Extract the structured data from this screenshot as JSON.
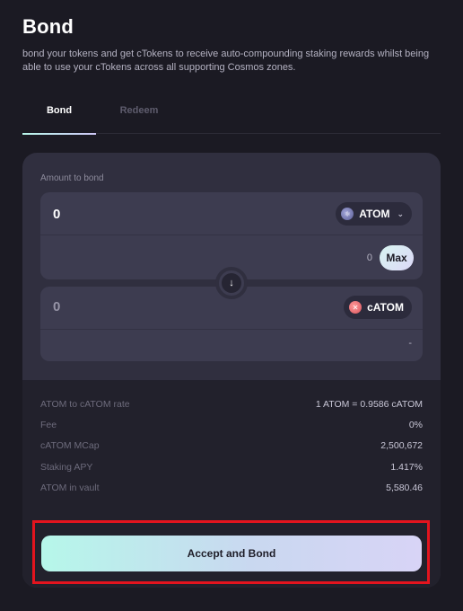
{
  "page": {
    "title": "Bond",
    "description": "bond your tokens and get cTokens to receive auto-compounding staking rewards whilst being able to use your cTokens across all supporting Cosmos zones."
  },
  "tabs": [
    {
      "label": "Bond",
      "active": true
    },
    {
      "label": "Redeem",
      "active": false
    }
  ],
  "bond_form": {
    "amount_label": "Amount to bond",
    "input_value": "0",
    "input_token": "ATOM",
    "balance": "0",
    "max_label": "Max",
    "output_value": "0",
    "output_token": "cATOM",
    "output_secondary": "-"
  },
  "stats": [
    {
      "label": "ATOM to cATOM rate",
      "value": "1 ATOM = 0.9586 cATOM"
    },
    {
      "label": "Fee",
      "value": "0%"
    },
    {
      "label": "cATOM MCap",
      "value": "2,500,672"
    },
    {
      "label": "Staking APY",
      "value": "1.417%"
    },
    {
      "label": "ATOM in vault",
      "value": "5,580.46"
    }
  ],
  "actions": {
    "accept_label": "Accept and Bond"
  },
  "colors": {
    "background": "#1b1a23",
    "card": "#302f3f",
    "highlight": "#e3141e"
  },
  "icons": {
    "atom_token": "atom-token-icon",
    "catom_token": "catom-token-icon",
    "swap": "arrow-down-icon"
  }
}
